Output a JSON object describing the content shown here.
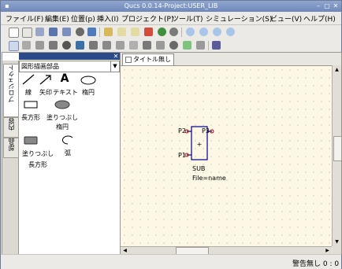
{
  "window": {
    "title": "Qucs 0.0.14-Project:USER_LIB"
  },
  "menu": [
    "ファイル(F)",
    "編集(E)",
    "位置(p)",
    "挿入(I)",
    "プロジェクト(P)",
    "ツール(T)",
    "シミュレーション(S)",
    "ビュー(V)",
    "ヘルプ(H)"
  ],
  "dock": {
    "tabs": [
      "プロジェクト",
      "内容",
      "部品"
    ],
    "category": "図形描画部品",
    "items": [
      {
        "label": "線"
      },
      {
        "label": "矢印"
      },
      {
        "label": "テキスト",
        "glyph": "A"
      },
      {
        "label": "楕円"
      },
      {
        "label": "長方形"
      },
      {
        "label": "塗りつぶし楕円"
      },
      {
        "label": "塗りつぶし長方形"
      },
      {
        "label": "弧"
      }
    ]
  },
  "editor": {
    "tab": "タイトル無し",
    "component": {
      "p2": "P2",
      "p3": "P3",
      "p1": "P1",
      "name": "SUB",
      "param": "File=name"
    }
  },
  "status": {
    "text": "警告無し 0 : 0"
  },
  "colors": {
    "titlebar": "#6f88ba",
    "dock_title": "#2b4a8a",
    "canvas": "#fdf8e6",
    "wire": "#00008b",
    "port": "#cc0000"
  }
}
